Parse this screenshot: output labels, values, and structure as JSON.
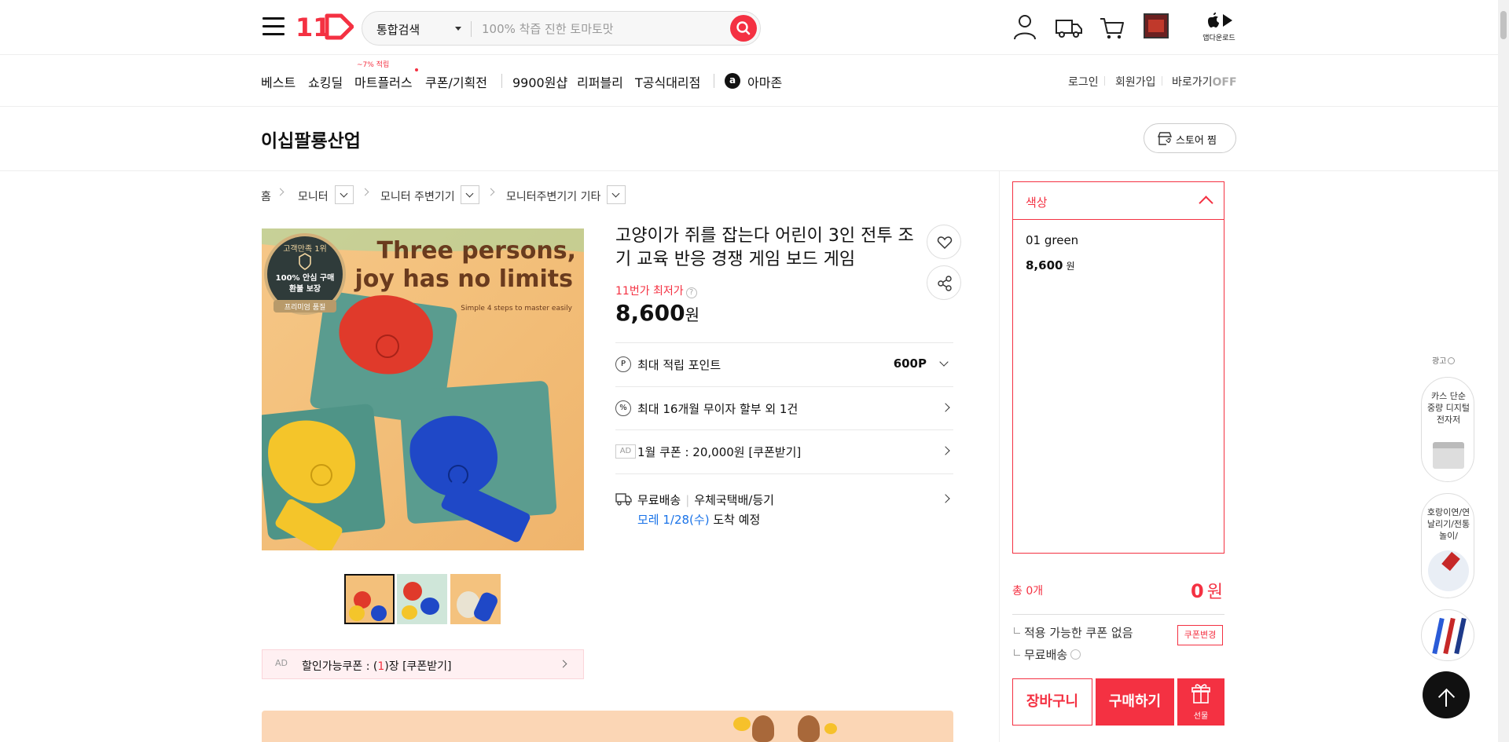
{
  "header": {
    "logo_text": "11",
    "search": {
      "category": "통합검색",
      "placeholder": "100% 착즙 진한 토마토맛"
    },
    "app_download_label": "앱다운로드"
  },
  "nav": {
    "items": [
      {
        "label": "베스트"
      },
      {
        "label": "쇼킹딜"
      },
      {
        "label": "마트플러스",
        "badge": "~7% 적립"
      },
      {
        "label": "쿠폰/기획전"
      },
      {
        "label": "9900원샵"
      },
      {
        "label": "리퍼블리"
      },
      {
        "label": "T공식대리점"
      },
      {
        "label": "아마존",
        "icon_letter": "a"
      }
    ],
    "util": {
      "login": "로그인",
      "signup": "회원가입",
      "shortcut": "바로가기",
      "shortcut_state": "OFF"
    }
  },
  "store": {
    "name": "이십팔룡산업",
    "follow_label": "스토어 찜"
  },
  "breadcrumb": {
    "home": "홈",
    "level1": "모니터",
    "level2": "모니터 주변기기",
    "level3": "모니터주변기기 기타"
  },
  "product": {
    "image_text": {
      "headline_1": "Three persons,",
      "headline_2": "joy has no limits",
      "sub": "Simple 4 steps to master easily",
      "seal_1": "고객만족 1위",
      "seal_2": "100% 안심 구매",
      "seal_3": "환불 보장",
      "seal_4": "프리미엄 품질"
    },
    "title": "고양이가 쥐를 잡는다 어린이 3인 전투 조기 교육 반응 경쟁 게임 보드 게임",
    "lowest_label": "11번가 최저가",
    "price": "8,600",
    "price_unit": "원",
    "coupon_banner": {
      "ad": "AD",
      "text_prefix": "할인가능쿠폰 : (",
      "count": "1",
      "text_suffix": ")장 [쿠폰받기]"
    },
    "rows": {
      "points_label": "최대 적립 포인트",
      "points_value": "600P",
      "installment_label": "최대 16개월 무이자 할부 외 1건",
      "coupon_ad": "AD",
      "coupon_label": "1월 쿠폰 : 20,000원 [쿠폰받기]",
      "shipping_free": "무료배송",
      "shipping_method": "우체국택배/등기",
      "arrival_date": "모레 1/28(수)",
      "arrival_suffix": "도착 예정"
    }
  },
  "option_panel": {
    "title": "색상",
    "option_name": "01 green",
    "option_price": "8,600",
    "option_price_unit": "원",
    "total_label": "총 0개",
    "total_value": "0",
    "total_unit": "원",
    "no_coupon": "적용 가능한 쿠폰 없음",
    "coupon_change": "쿠폰변경",
    "free_shipping": "무료배송",
    "cart_label": "장바구니",
    "buy_label": "구매하기",
    "gift_label": "선물"
  },
  "side_ads": {
    "label": "광고",
    "items": [
      {
        "text": "카스 단순 중량 디지털 전자저"
      },
      {
        "text": "호랑이연/연날리기/전통놀이/"
      },
      {
        "text": ""
      }
    ]
  },
  "colors": {
    "accent": "#f43142",
    "link_blue": "#1a73e8"
  },
  "icons": [
    "hamburger-icon",
    "search-icon",
    "user-icon",
    "truck-icon",
    "cart-icon",
    "recent-view-icon",
    "apple-icon",
    "play-store-icon",
    "heart-icon",
    "share-icon",
    "store-icon",
    "chevron-down-icon",
    "point-icon",
    "installment-icon",
    "delivery-icon",
    "gift-icon",
    "arrow-up-icon"
  ]
}
